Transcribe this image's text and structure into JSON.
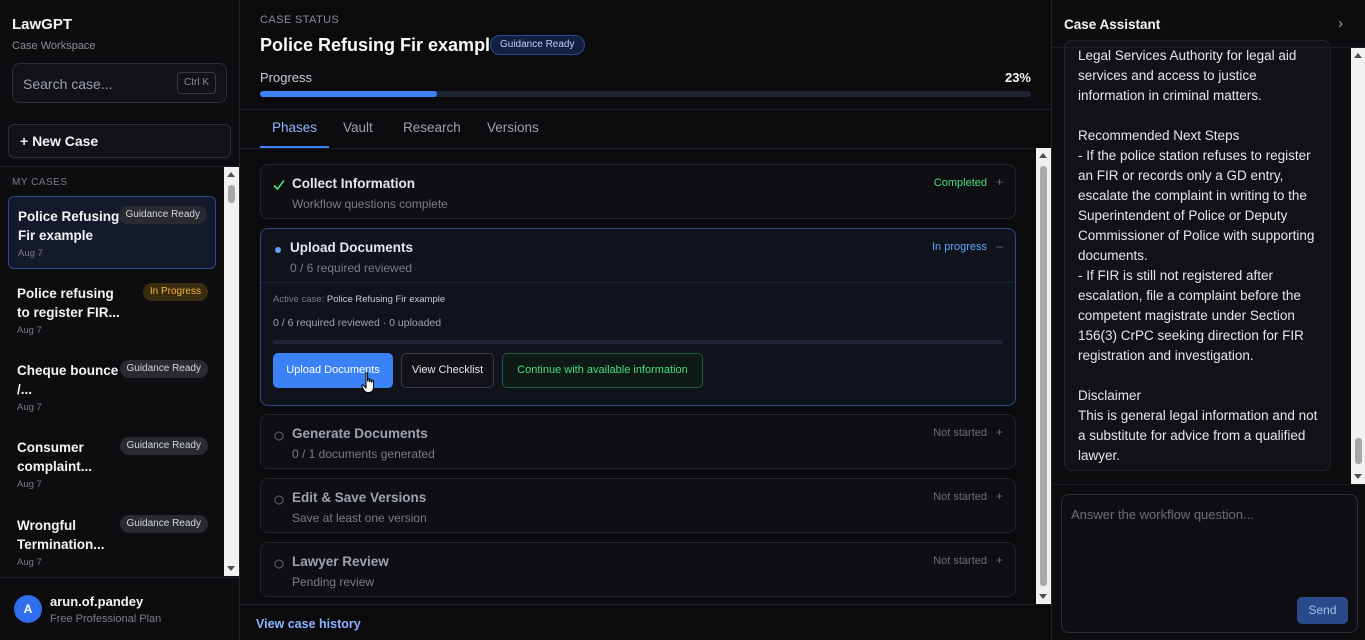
{
  "sidebar": {
    "brand": "LawGPT",
    "brand_sub": "Case Workspace",
    "search_placeholder": "Search case...",
    "search_shortcut": "Ctrl K",
    "new_case": "+ New Case",
    "section_label": "MY CASES",
    "cases": [
      {
        "title": "Police Refusing Fir example",
        "badge": "Guidance Ready",
        "date": "Aug 7",
        "active": true
      },
      {
        "title": "Police refusing to register FIR...",
        "badge": "In Progress",
        "date": "Aug 7"
      },
      {
        "title": "Cheque bounce /...",
        "badge": "Guidance Ready",
        "date": "Aug 7"
      },
      {
        "title": "Consumer complaint...",
        "badge": "Guidance Ready",
        "date": "Aug 7"
      },
      {
        "title": "Wrongful Termination...",
        "badge": "Guidance Ready",
        "date": "Aug 7"
      }
    ],
    "user": {
      "initial": "A",
      "name": "arun.of.pandey",
      "plan": "Free Professional Plan"
    }
  },
  "main": {
    "case_status_label": "CASE STATUS",
    "title": "Police Refusing Fir example",
    "badge": "Guidance Ready",
    "progress_label": "Progress",
    "progress_pct": "23%",
    "progress_value": 0.23,
    "tabs": [
      "Phases",
      "Vault",
      "Research",
      "Versions"
    ],
    "active_tab": "Phases",
    "phases": [
      {
        "title": "Collect Information",
        "subtitle": "Workflow questions complete",
        "status": "Completed",
        "toggle": "+"
      },
      {
        "title": "Upload Documents",
        "subtitle": "0 / 6 required reviewed",
        "status": "In progress",
        "toggle": "–",
        "active_case_label": "Active case:",
        "active_case_value": "Police Refusing Fir example",
        "summary": "0 / 6 required reviewed · 0 uploaded",
        "buttons": {
          "upload": "Upload Documents",
          "checklist": "View Checklist",
          "continue": "Continue with available information"
        }
      },
      {
        "title": "Generate Documents",
        "subtitle": "0 / 1 documents generated",
        "status": "Not started",
        "toggle": "+"
      },
      {
        "title": "Edit & Save Versions",
        "subtitle": "Save at least one version",
        "status": "Not started",
        "toggle": "+"
      },
      {
        "title": "Lawyer Review",
        "subtitle": "Pending review",
        "status": "Not started",
        "toggle": "+"
      }
    ],
    "history_link": "View case history"
  },
  "assistant": {
    "title": "Case Assistant",
    "message": "Legal Services Authority for legal aid services and access to justice information in criminal matters.\n\nRecommended Next Steps\n- If the police station refuses to register an FIR or records only a GD entry, escalate the complaint in writing to the Superintendent of Police or Deputy Commissioner of Police with supporting documents.\n- If FIR is still not registered after escalation, file a complaint before the competent magistrate under Section 156(3) CrPC seeking direction for FIR registration and investigation.\n\nDisclaimer\nThis is general legal information and not a substitute for advice from a qualified lawyer.",
    "input_placeholder": "Answer the workflow question...",
    "send": "Send"
  },
  "colors": {
    "accent": "#3b82f6",
    "success": "#4ade80",
    "warning": "#f5b544"
  }
}
